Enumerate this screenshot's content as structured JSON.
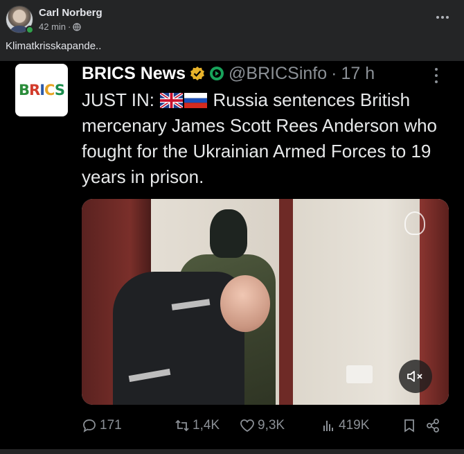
{
  "post": {
    "author": "Carl Norberg",
    "time": "42 min",
    "separator": "·",
    "text": "Klimatkrisskapande.."
  },
  "tweet": {
    "logo_text": [
      "B",
      "R",
      "I",
      "C",
      "S"
    ],
    "name": "BRICS News",
    "handle": "@BRICSinfo",
    "dot": "·",
    "time": "17 h",
    "body_prefix": "JUST IN:",
    "body_text": "Russia sentences British mercenary James Scott Rees Anderson who fought for the Ukrainian Armed Forces to 19 years in prison.",
    "flags": [
      "uk-flag-icon",
      "russia-flag-icon"
    ],
    "actions": {
      "replies": "171",
      "retweets": "1,4K",
      "likes": "9,3K",
      "views": "419K"
    }
  },
  "colors": {
    "background": "#242526",
    "tweet_background": "#000000",
    "muted": "#8b9096",
    "online": "#31a24c"
  }
}
